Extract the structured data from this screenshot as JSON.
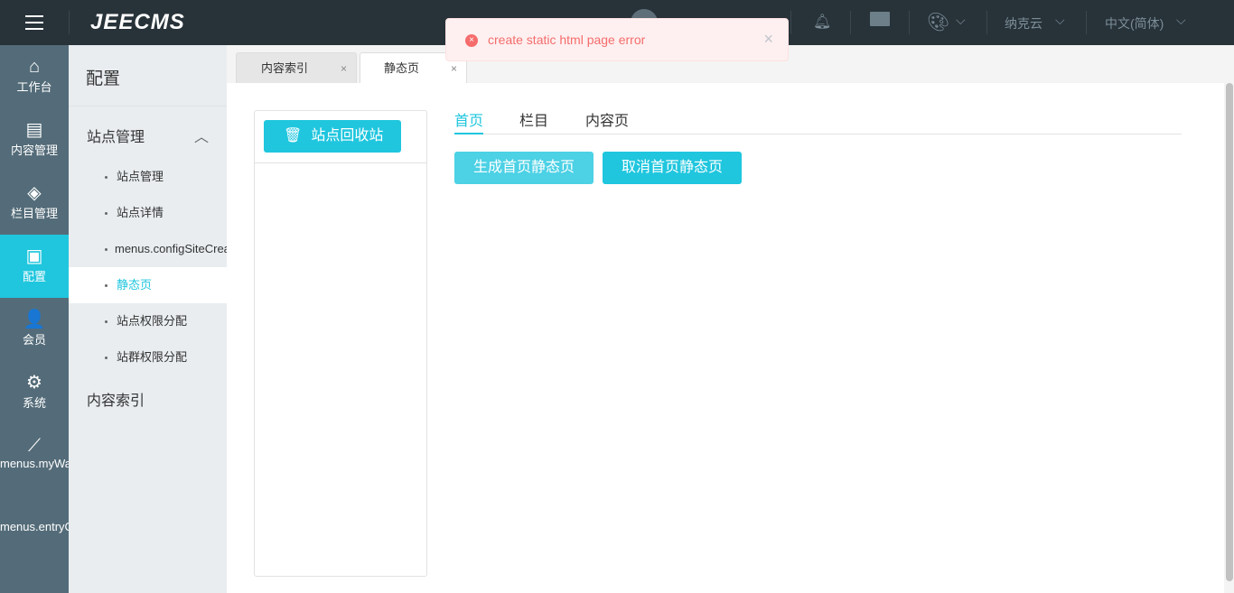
{
  "header": {
    "logo": "JEECMS",
    "site": "纳克云",
    "language": "中文(简体)",
    "chevron": "⌵"
  },
  "sidebar": [
    {
      "label": "工作台",
      "icon": "⌂"
    },
    {
      "label": "内容管理",
      "icon": "▤"
    },
    {
      "label": "栏目管理",
      "icon": "◈"
    },
    {
      "label": "配置",
      "icon": "▣"
    },
    {
      "label": "会员",
      "icon": "👤"
    },
    {
      "label": "系统",
      "icon": "⚙"
    },
    {
      "label": "menus.myWaitTask",
      "icon": "⟋"
    },
    {
      "label": "menus.entryCheck",
      "icon": ""
    }
  ],
  "submenu": {
    "title": "配置",
    "group": "站点管理",
    "items": [
      "站点管理",
      "站点详情",
      "menus.configSiteCreate",
      "静态页",
      "站点权限分配",
      "站群权限分配"
    ],
    "other": "内容索引"
  },
  "tabs": [
    {
      "label": "内容索引"
    },
    {
      "label": "静态页"
    }
  ],
  "close": "×",
  "panel": {
    "recycle_button": "站点回收站"
  },
  "subtabs": [
    "首页",
    "栏目",
    "内容页"
  ],
  "actions": {
    "generate": "生成首页静态页",
    "cancel": "取消首页静态页"
  },
  "toast": {
    "message": "create static html page error",
    "icon": "×",
    "close": "×"
  }
}
